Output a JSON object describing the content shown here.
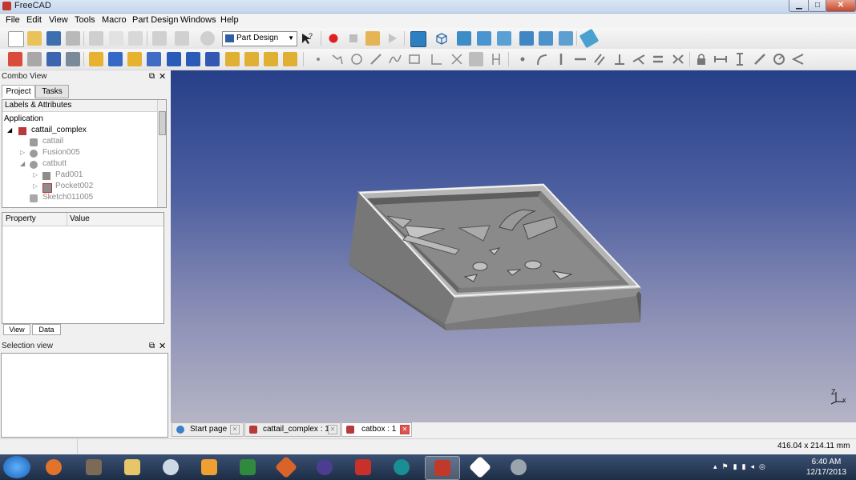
{
  "window": {
    "title": "FreeCAD",
    "min_glyph": "▁",
    "max_glyph": "□",
    "close_glyph": "✕"
  },
  "menu": [
    "File",
    "Edit",
    "View",
    "Tools",
    "Macro",
    "Part Design",
    "Windows",
    "Help"
  ],
  "workbench": {
    "selected": "Part Design",
    "arrow": "▼"
  },
  "combo": {
    "title": "Combo View",
    "tabs": [
      "Project",
      "Tasks"
    ],
    "tree_header": "Labels & Attributes",
    "tree": [
      {
        "label": "Application"
      },
      {
        "label": "cattail_complex"
      },
      {
        "label": "cattail"
      },
      {
        "label": "Fusion005"
      },
      {
        "label": "catbutt"
      },
      {
        "label": "Pad001"
      },
      {
        "label": "Pocket002"
      },
      {
        "label": "Sketch011005"
      }
    ],
    "property_col": "Property",
    "value_col": "Value",
    "bottom_tabs": [
      "View",
      "Data"
    ]
  },
  "selection": {
    "title": "Selection view"
  },
  "doc_tabs": [
    {
      "label": "Start page"
    },
    {
      "label": "cattail_complex : 1"
    },
    {
      "label": "catbox : 1"
    }
  ],
  "status": {
    "dimensions": "416.04 x 214.11 mm"
  },
  "axis": {
    "z": "Z",
    "x": "x"
  },
  "taskbar": {
    "time": "6:40 AM",
    "date": "12/17/2013"
  },
  "colors": {
    "viewport_top": "#263f89",
    "viewport_bottom": "#b5b5c6",
    "record": "#e02020"
  }
}
